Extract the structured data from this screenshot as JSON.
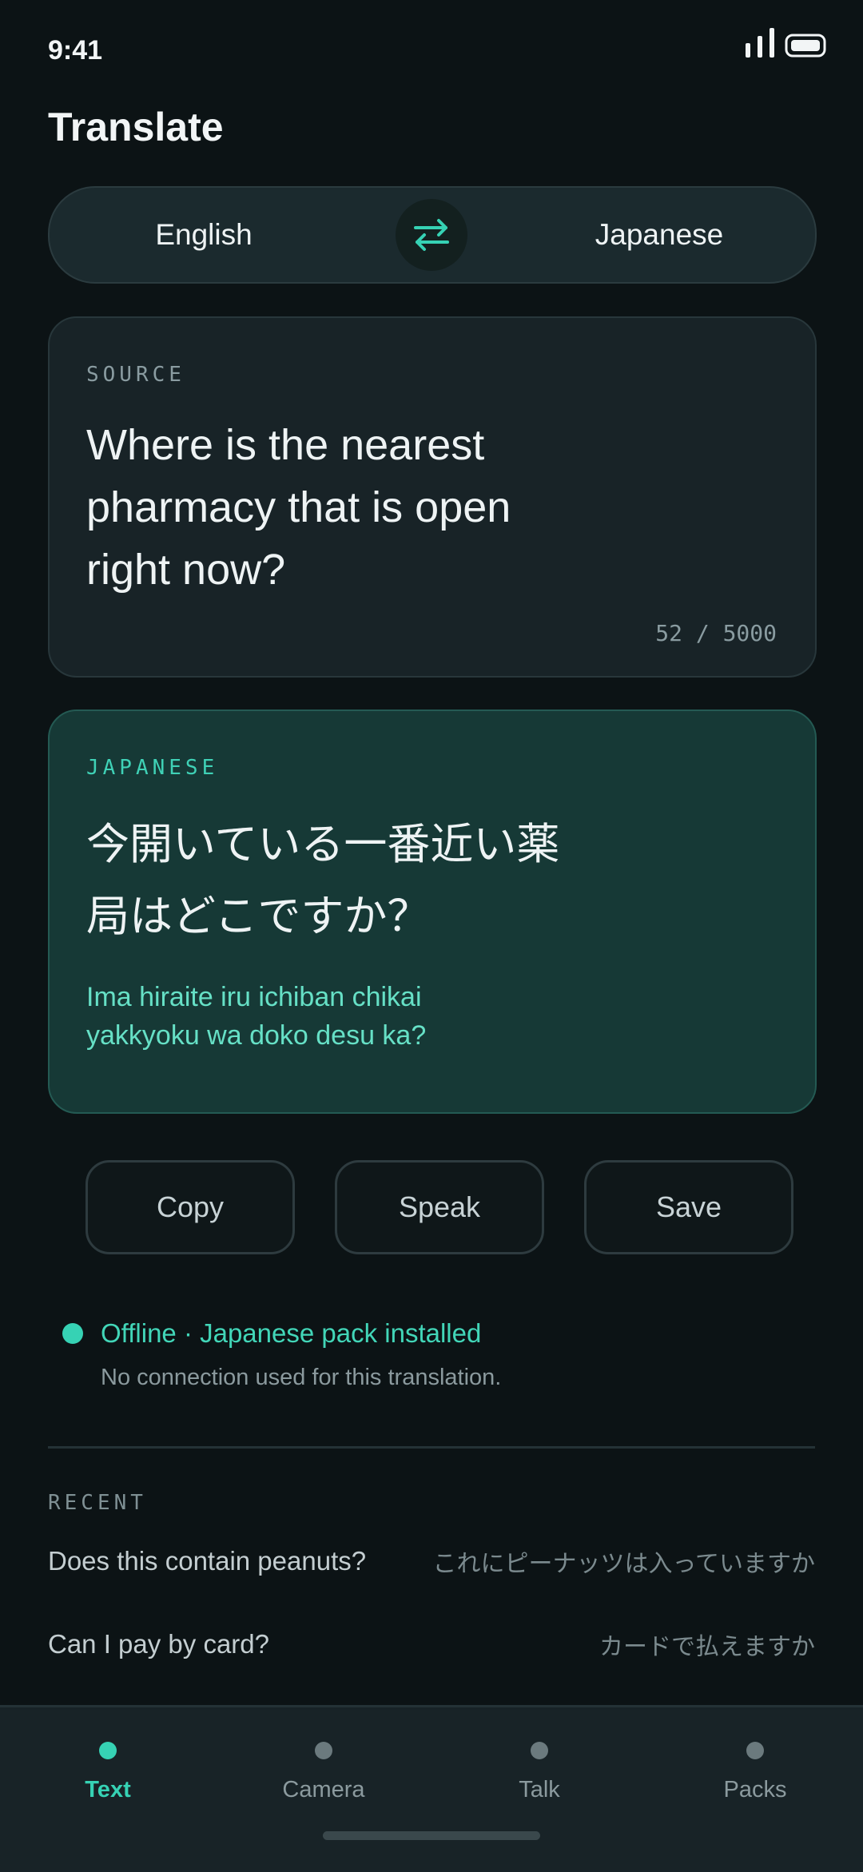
{
  "status_bar": {
    "time": "9:41",
    "signal_icon": "signal-bars-icon",
    "battery_icon": "battery-icon"
  },
  "header": {
    "title": "Translate"
  },
  "language_switcher": {
    "source_language": "English",
    "target_language": "Japanese",
    "swap_icon": "swap-arrows-icon"
  },
  "source": {
    "label": "SOURCE",
    "text": "Where is the nearest pharmacy that is open right now?",
    "char_count": "52 / 5000"
  },
  "translation": {
    "label": "JAPANESE",
    "text": "今開いている一番近い薬局はどこですか？",
    "romanization": "Ima hiraite iru ichiban chikai yakkyoku wa doko desu ka?"
  },
  "actions": {
    "copy": "Copy",
    "speak": "Speak",
    "save": "Save"
  },
  "offline_status": {
    "title": "Offline · Japanese pack installed",
    "subtitle": "No connection used for this translation."
  },
  "recent": {
    "label": "RECENT",
    "items": [
      {
        "source": "Does this contain peanuts?",
        "target": "これにピーナッツは入っていますか"
      },
      {
        "source": "Can I pay by card?",
        "target": "カードで払えますか"
      }
    ]
  },
  "bottom_nav": {
    "items": [
      {
        "label": "Text",
        "active": true
      },
      {
        "label": "Camera",
        "active": false
      },
      {
        "label": "Talk",
        "active": false
      },
      {
        "label": "Packs",
        "active": false
      }
    ]
  },
  "colors": {
    "background": "#0c1315",
    "accent": "#36d2b4",
    "card": "#182327",
    "translation_card": "#163936"
  }
}
